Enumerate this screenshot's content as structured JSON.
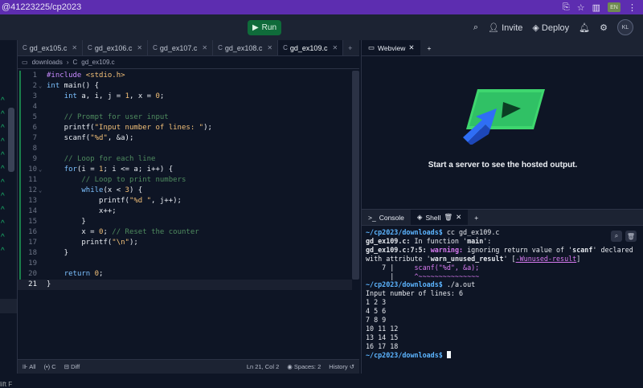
{
  "browser": {
    "url": "@41223225/cp2023",
    "ext_badge": "EN"
  },
  "appbar": {
    "run_label": "Run",
    "invite_label": "Invite",
    "deploy_label": "Deploy",
    "avatar_initials": "KL"
  },
  "sidebar": {
    "cut_label": "lift F"
  },
  "editor": {
    "tabs": [
      {
        "label": "gd_ex105.c"
      },
      {
        "label": "gd_ex106.c"
      },
      {
        "label": "gd_ex107.c"
      },
      {
        "label": "gd_ex108.c"
      },
      {
        "label": "gd_ex109.c",
        "active": true
      }
    ],
    "breadcrumb": {
      "folder": "downloads",
      "file": "gd_ex109.c"
    },
    "lines": [
      {
        "n": "1",
        "html": "<span class='pp'>#include</span> <span class='s'>&lt;stdio.h&gt;</span>"
      },
      {
        "n": "2",
        "fold": "⌄",
        "html": "<span class='k'>int</span> main() {"
      },
      {
        "n": "3",
        "html": "    <span class='k'>int</span> a, i, j = <span class='n'>1</span>, x = <span class='n'>0</span>;"
      },
      {
        "n": "4",
        "html": ""
      },
      {
        "n": "5",
        "html": "    <span class='cm'>// Prompt for user input</span>"
      },
      {
        "n": "6",
        "html": "    printf(<span class='s'>\"Input number of lines: \"</span>);"
      },
      {
        "n": "7",
        "html": "    scanf(<span class='s'>\"%d\"</span>, &amp;a);"
      },
      {
        "n": "8",
        "html": ""
      },
      {
        "n": "9",
        "html": "    <span class='cm'>// Loop for each line</span>"
      },
      {
        "n": "10",
        "fold": "⌄",
        "html": "    <span class='k'>for</span>(i = <span class='n'>1</span>; i &lt;= a; i++) {"
      },
      {
        "n": "11",
        "html": "        <span class='cm'>// Loop to print numbers</span>"
      },
      {
        "n": "12",
        "fold": "⌄",
        "html": "        <span class='k'>while</span>(x &lt; <span class='n'>3</span>) {"
      },
      {
        "n": "13",
        "html": "            printf(<span class='s'>\"%d \"</span>, j++);"
      },
      {
        "n": "14",
        "html": "            x++;"
      },
      {
        "n": "15",
        "html": "        }"
      },
      {
        "n": "16",
        "html": "        x = <span class='n'>0</span>; <span class='cm'>// Reset the counter</span>"
      },
      {
        "n": "17",
        "html": "        printf(<span class='s'>\"\\n\"</span>);"
      },
      {
        "n": "18",
        "html": "    }"
      },
      {
        "n": "19",
        "html": ""
      },
      {
        "n": "20",
        "html": "    <span class='k'>return</span> <span class='n'>0</span>;"
      },
      {
        "n": "21",
        "html": "}",
        "current": true
      }
    ],
    "status": {
      "all": "All",
      "lang": "(•) C",
      "diff": "Diff",
      "position": "Ln 21, Col 2",
      "spaces": "Spaces: 2",
      "history": "History"
    }
  },
  "webview": {
    "tab_label": "Webview",
    "message": "Start a server to see the hosted output."
  },
  "shell": {
    "console_label": "Console",
    "shell_label": "Shell",
    "lines": [
      "<span class='t-path'>~/cp2023/downloads$</span> cc gd_ex109.c",
      "<span class='t-bold'>gd_ex109.c:</span> In function '<span class='t-bold'>main</span>':",
      "<span class='t-bold'>gd_ex109.c:7:5:</span> <span class='t-warn'>warning:</span> ignoring return value of '<span class='t-bold'>scanf</span>' declared",
      "with attribute '<span class='t-bold'>warn_unused_result</span>' [<span class='t-link'>-Wunused-result</span>]",
      "    7 |     <span class='t-pink'>scanf(\"%d\", &amp;a);</span>",
      "      |     <span class='t-pink'>^~~~~~~~~~~~~~~~</span>",
      "<span class='t-path'>~/cp2023/downloads$</span> ./a.out",
      "Input number of lines: 6",
      "1 2 3",
      "4 5 6",
      "7 8 9",
      "10 11 12",
      "13 14 15",
      "16 17 18",
      "<span class='t-path'>~/cp2023/downloads$</span> <span class='cursor'></span>"
    ]
  },
  "colors": {
    "browser_bar": "#5d2db0",
    "app_bg": "#0e1525",
    "panel_bg": "#1c2333",
    "run_green": "#0f6b3a",
    "illustration_green": "#3ed66e",
    "illustration_blue": "#2f6ef5"
  }
}
